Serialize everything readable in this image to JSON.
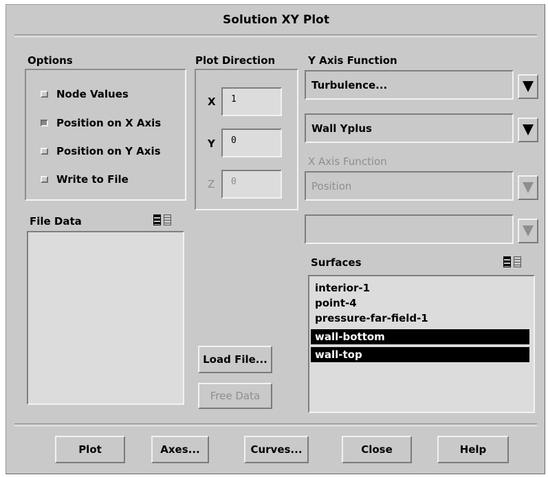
{
  "window": {
    "title": "Solution XY Plot"
  },
  "options": {
    "label": "Options",
    "items": [
      {
        "label": "Node Values",
        "checked": false
      },
      {
        "label": "Position on X Axis",
        "checked": true
      },
      {
        "label": "Position on Y Axis",
        "checked": false
      },
      {
        "label": "Write to File",
        "checked": false
      }
    ]
  },
  "plot_direction": {
    "label": "Plot Direction",
    "x": {
      "label": "X",
      "value": "1"
    },
    "y": {
      "label": "Y",
      "value": "0"
    },
    "z": {
      "label": "Z",
      "value": "0",
      "disabled": true
    }
  },
  "y_axis_function": {
    "label": "Y Axis Function",
    "category": "Turbulence...",
    "quantity": "Wall Yplus"
  },
  "x_axis_function": {
    "label": "X Axis Function",
    "category": "Position",
    "quantity": "",
    "disabled": true
  },
  "file_data": {
    "label": "File Data",
    "items": []
  },
  "surfaces": {
    "label": "Surfaces",
    "items": [
      {
        "label": "interior-1",
        "selected": false
      },
      {
        "label": "point-4",
        "selected": false
      },
      {
        "label": "pressure-far-field-1",
        "selected": false
      },
      {
        "label": "wall-bottom",
        "selected": true
      },
      {
        "label": "wall-top",
        "selected": true
      }
    ]
  },
  "file_buttons": {
    "load": "Load File...",
    "free": "Free Data"
  },
  "buttons": {
    "plot": "Plot",
    "axes": "Axes...",
    "curves": "Curves...",
    "close": "Close",
    "help": "Help"
  },
  "icons": {
    "dropdown": "triangle-down-icon",
    "multi_select": "multi-select-icon",
    "single_select": "single-select-icon"
  }
}
